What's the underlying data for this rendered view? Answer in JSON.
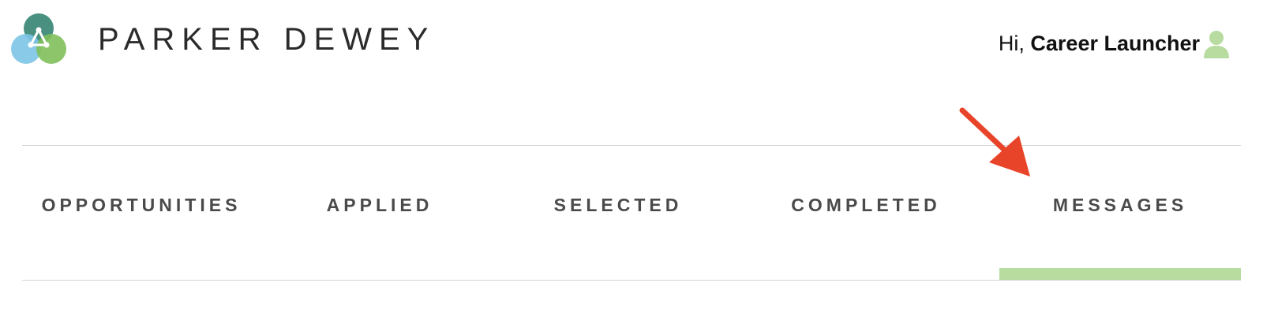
{
  "header": {
    "brand": "PARKER DEWEY",
    "greeting_prefix": "Hi,",
    "user_name": "Career Launcher",
    "logo_icon": "parker-dewey-logo-icon",
    "avatar_icon": "user-avatar-icon"
  },
  "nav": {
    "tabs": [
      {
        "label": "OPPORTUNITIES",
        "active": false
      },
      {
        "label": "APPLIED",
        "active": false
      },
      {
        "label": "SELECTED",
        "active": false
      },
      {
        "label": "COMPLETED",
        "active": false
      },
      {
        "label": "MESSAGES",
        "active": true
      }
    ],
    "active_indicator_color": "#b8dba0"
  },
  "annotation": {
    "arrow_color": "#e8442a",
    "arrow_icon": "red-arrow-icon"
  },
  "colors": {
    "logo_teal": "#3f8a7a",
    "logo_blue": "#7cc4e6",
    "logo_green": "#7fbf5a",
    "avatar": "#b8dba0",
    "tab_text": "#4a4a4a"
  }
}
